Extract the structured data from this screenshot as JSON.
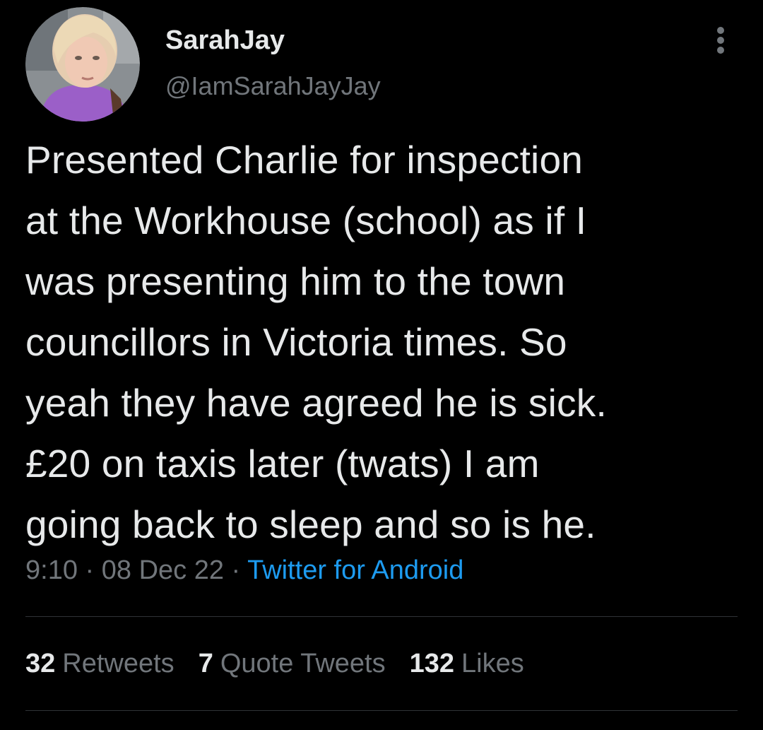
{
  "user": {
    "display_name": "SarahJay",
    "handle": "@IamSarahJayJay",
    "avatar_icon": "profile-photo"
  },
  "more_options_icon": "more-vertical-icon",
  "tweet": {
    "text": "Presented Charlie for inspection\nat the Workhouse (school) as if I\nwas presenting him to the town\ncouncillors in Victoria times. So\nyeah they have agreed he is sick.\n£20 on taxis later (twats) I am\ngoing back to sleep and so is he.",
    "time": "9:10",
    "separator": "·",
    "date": "08 Dec 22",
    "source": "Twitter for Android"
  },
  "stats": {
    "retweets_count": "32",
    "retweets_label": "Retweets",
    "quotes_count": "7",
    "quotes_label": "Quote Tweets",
    "likes_count": "132",
    "likes_label": "Likes"
  },
  "colors": {
    "background": "#000000",
    "primary_text": "#e7e9ea",
    "secondary_text": "#71767b",
    "link": "#1d9bf0",
    "divider": "#2f3336"
  }
}
